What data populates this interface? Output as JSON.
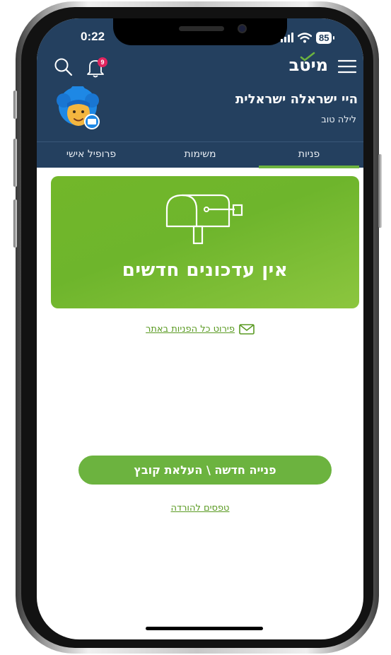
{
  "status_bar": {
    "time": "0:22",
    "battery": "85"
  },
  "top_bar": {
    "logo": "מיטב",
    "notifications_count": "9",
    "icons": [
      "menu-icon",
      "search-icon",
      "bell-icon",
      "wifi-icon",
      "signal-icon",
      "battery-icon"
    ]
  },
  "user": {
    "greeting": "היי ישראלה ישראלית",
    "subgreeting": "לילה טוב"
  },
  "tabs": [
    {
      "label": "פניות",
      "active": true
    },
    {
      "label": "משימות",
      "active": false
    },
    {
      "label": "פרופיל אישי",
      "active": false
    }
  ],
  "banner": {
    "title": "אין עדכונים חדשים",
    "icon": "mailbox-icon"
  },
  "links": {
    "all_inquiries": "פירוט כל הפניות באתר",
    "new_inquiry_button": "פנייה חדשה \\ העלאת קובץ",
    "download_forms": "טפסים להורדה"
  },
  "colors": {
    "header_bg": "#24405f",
    "accent_green": "#6cb33f",
    "link_green": "#5a9a22",
    "badge_red": "#e0245e"
  }
}
